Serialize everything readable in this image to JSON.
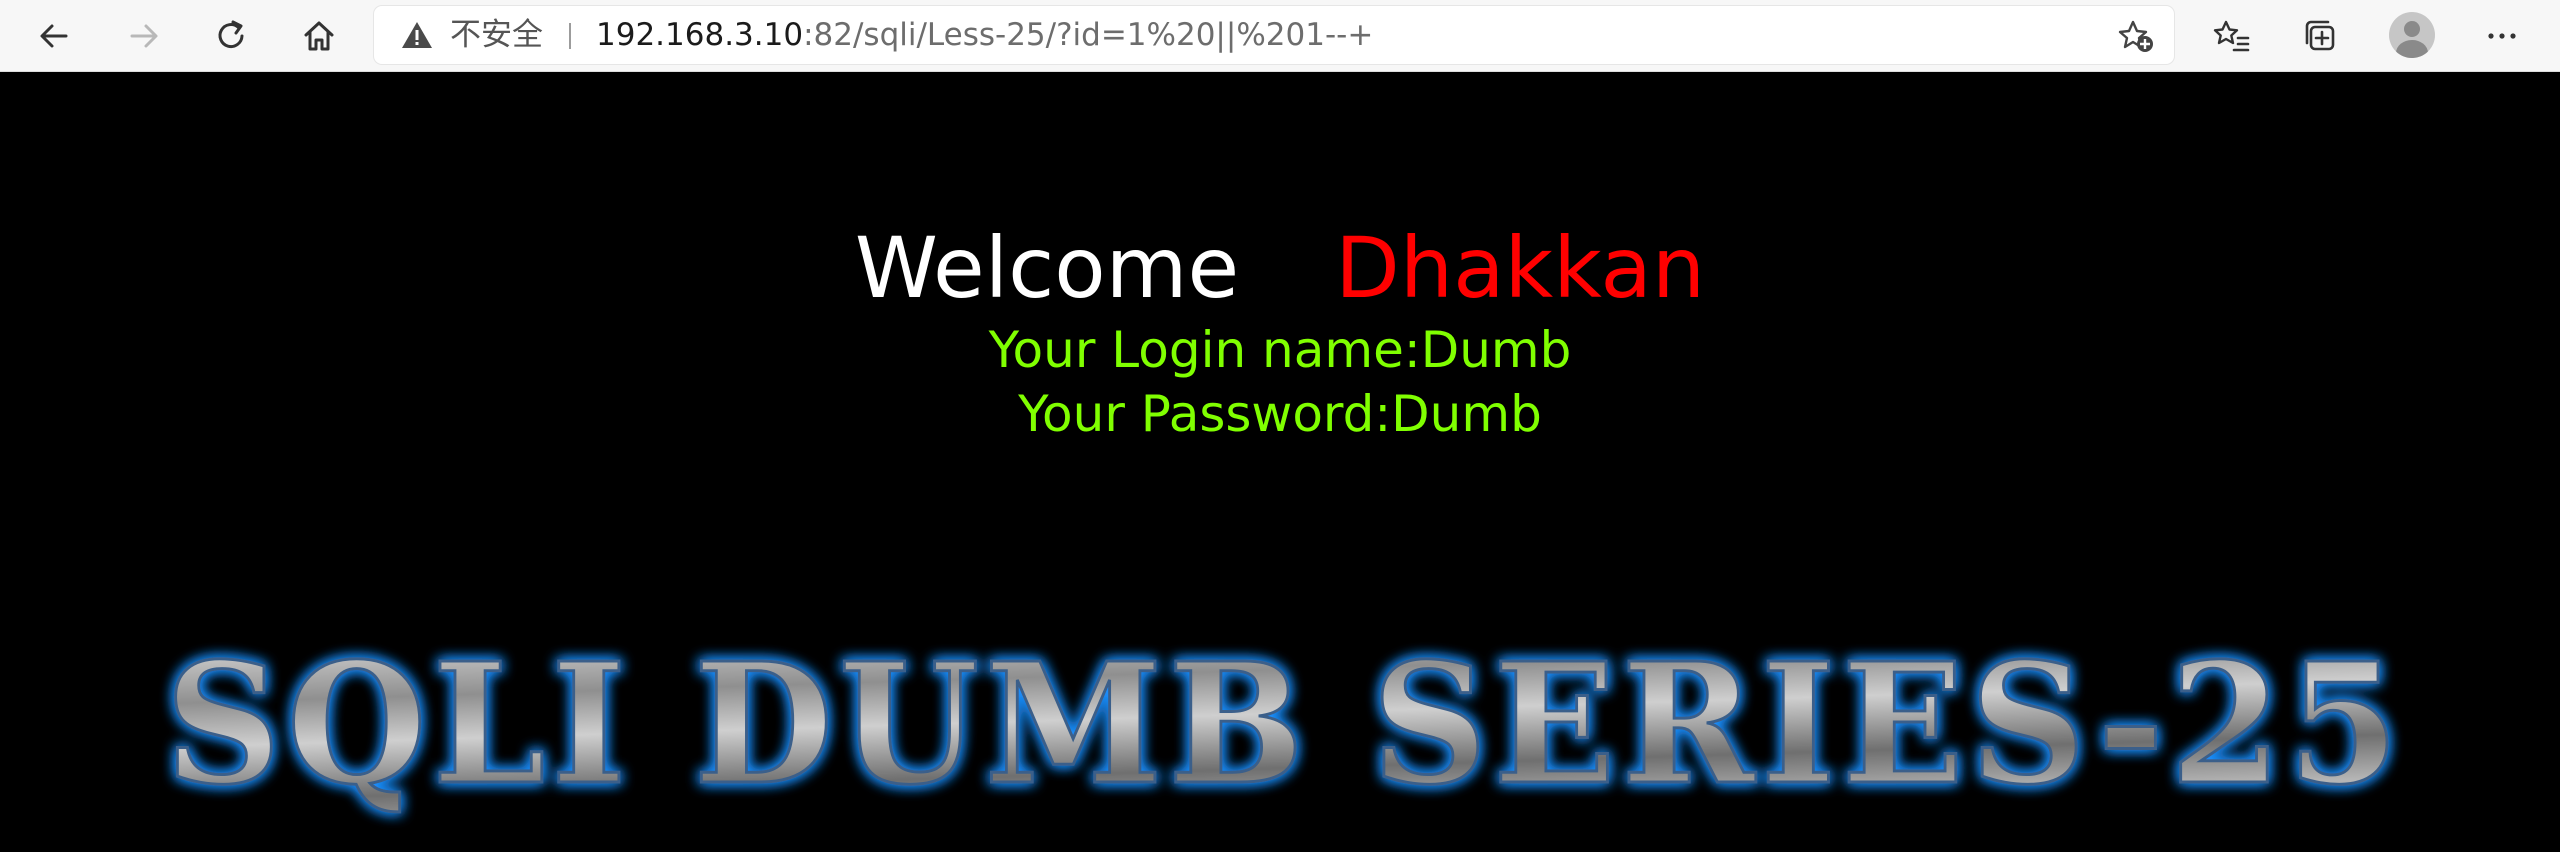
{
  "browser": {
    "security_label": "不安全",
    "url_host": "192.168.3.10",
    "url_rest": ":82/sqli/Less-25/?id=1%20||%201--+",
    "icons": [
      "back-icon",
      "forward-icon",
      "refresh-icon",
      "home-icon",
      "warning-icon",
      "add-favorite-icon",
      "favorites-icon",
      "collections-icon",
      "profile-icon",
      "more-icon"
    ]
  },
  "page": {
    "welcome": "Welcome",
    "name": "Dhakkan",
    "login_line": "Your Login name:Dumb",
    "password_line": "Your Password:Dumb",
    "banner_text": "SQLI DUMB SERIES-25",
    "colors": {
      "background": "#000000",
      "welcome": "#ffffff",
      "name": "#ff0000",
      "info": "#80ff00",
      "banner_glow": "#1e90ff"
    }
  }
}
